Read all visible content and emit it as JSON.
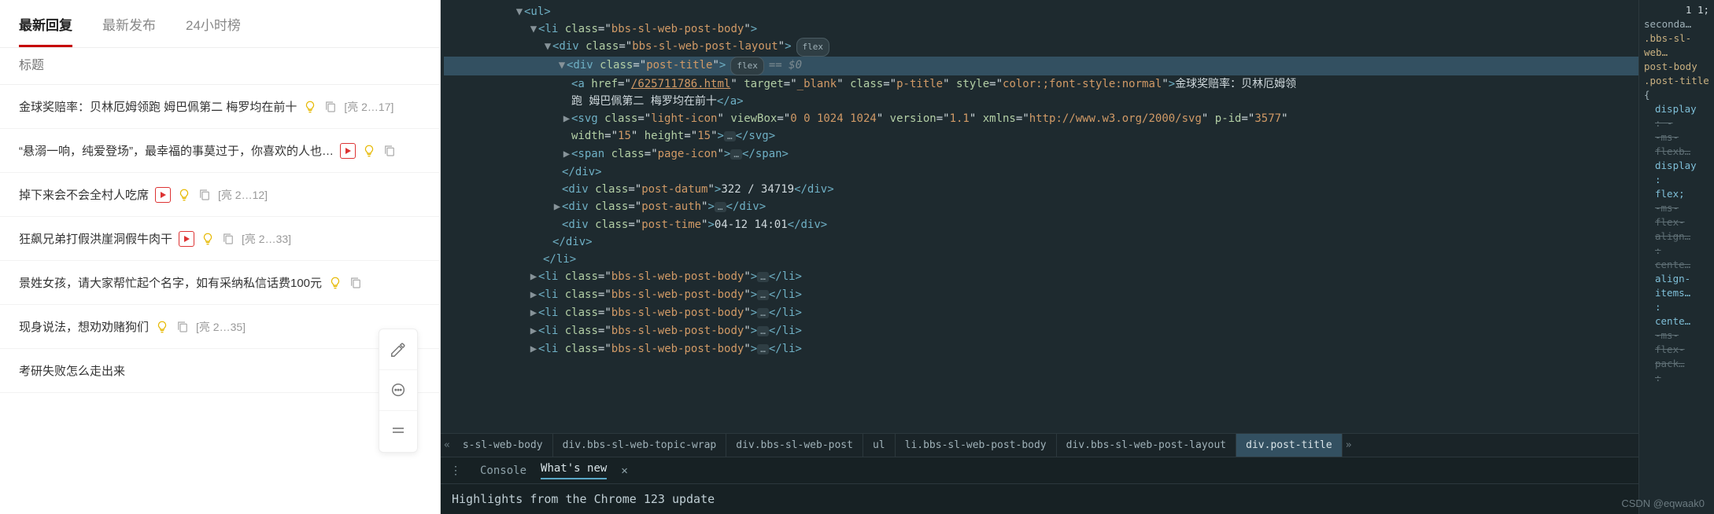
{
  "left": {
    "tabs": [
      "最新回复",
      "最新发布",
      "24小时榜"
    ],
    "active_tab": 0,
    "search_placeholder": "标题",
    "posts": [
      {
        "title": "金球奖赔率：贝林厄姆领跑 姆巴佩第二 梅罗均在前十",
        "bulb": true,
        "video": false,
        "copy": true,
        "meta": "[亮 2…17]"
      },
      {
        "title": "“悬溺一响，纯爱登场”，最幸福的事莫过于，你喜欢的人也…",
        "bulb": true,
        "video": true,
        "copy": true,
        "meta": ""
      },
      {
        "title": "掉下来会不会全村人吃席",
        "bulb": true,
        "video": true,
        "copy": true,
        "meta": "[亮 2…12]"
      },
      {
        "title": "狂飙兄弟打假洪崖洞假牛肉干",
        "bulb": true,
        "video": true,
        "copy": true,
        "meta": "[亮 2…33]"
      },
      {
        "title": "景姓女孩，请大家帮忙起个名字，如有采纳私信话费100元",
        "bulb": true,
        "video": false,
        "copy": true,
        "meta": ""
      },
      {
        "title": "现身说法，想劝劝赌狗们",
        "bulb": true,
        "video": false,
        "copy": true,
        "meta": "[亮 2…35]"
      },
      {
        "title": "考研失败怎么走出来",
        "bulb": false,
        "video": false,
        "copy": false,
        "meta": ""
      }
    ]
  },
  "devtools": {
    "dom": {
      "ul_open": "<ul>",
      "li_class": "bbs-sl-web-post-body",
      "layout_class": "bbs-sl-web-post-layout",
      "layout_badge": "flex",
      "post_title_class": "post-title",
      "post_title_badge": "flex",
      "post_title_dims": "== $0",
      "a_href": "/625711786.html",
      "a_target": "_blank",
      "a_class": "p-title",
      "a_style": "color:;font-style:normal",
      "a_text1": "金球奖赔率：贝林厄姆领",
      "a_text2": "跑 姆巴佩第二 梅罗均在前十",
      "svg_class": "light-icon",
      "svg_viewbox": "0 0 1024 1024",
      "svg_version": "1.1",
      "svg_xmlns": "http://www.w3.org/2000/svg",
      "svg_pid": "3577",
      "svg_width": "15",
      "svg_height": "15",
      "span_class": "page-icon",
      "datum_class": "post-datum",
      "datum_text": "322 / 34719",
      "auth_class": "post-auth",
      "time_class": "post-time",
      "time_text": "04-12 14:01"
    },
    "crumbs": [
      "s-sl-web-body",
      "div.bbs-sl-web-topic-wrap",
      "div.bbs-sl-web-post",
      "ul",
      "li.bbs-sl-web-post-body",
      "div.bbs-sl-web-post-layout",
      "div.post-title"
    ],
    "drawer": {
      "tabs": [
        "Console",
        "What's new"
      ],
      "active": 1,
      "headline": "Highlights from the Chrome 123 update"
    },
    "styles": {
      "pre": "1 1;",
      "sec": "seconda…",
      "r1": ".bbs-sl-web…",
      "r2": "post-body",
      "r3": ".post-title",
      "brace": "{",
      "lines": [
        {
          "k": "display",
          "v": ""
        },
        {
          "k": ": -",
          "v": "",
          "strike": true
        },
        {
          "k": "-ms-",
          "v": "",
          "strike": true
        },
        {
          "k": "flexb…",
          "v": "",
          "strike": true
        },
        {
          "k": "display",
          "v": ""
        },
        {
          "k": ":",
          "v": ""
        },
        {
          "k": "flex;",
          "v": ""
        },
        {
          "k": "-ms-",
          "v": "",
          "strike": true
        },
        {
          "k": "flex-",
          "v": "",
          "strike": true
        },
        {
          "k": "align…",
          "v": "",
          "strike": true
        },
        {
          "k": ":",
          "v": "",
          "strike": true
        },
        {
          "k": "cente…",
          "v": "",
          "strike": true
        },
        {
          "k": "align-",
          "v": ""
        },
        {
          "k": "items…",
          "v": ""
        },
        {
          "k": ":",
          "v": ""
        },
        {
          "k": "cente…",
          "v": ""
        },
        {
          "k": "-ms-",
          "v": "",
          "strike": true
        },
        {
          "k": "flex-",
          "v": "",
          "strike": true
        },
        {
          "k": "pack…",
          "v": "",
          "strike": true
        },
        {
          "k": ":",
          "v": "",
          "strike": true
        }
      ]
    }
  },
  "watermark": "CSDN @eqwaak0"
}
